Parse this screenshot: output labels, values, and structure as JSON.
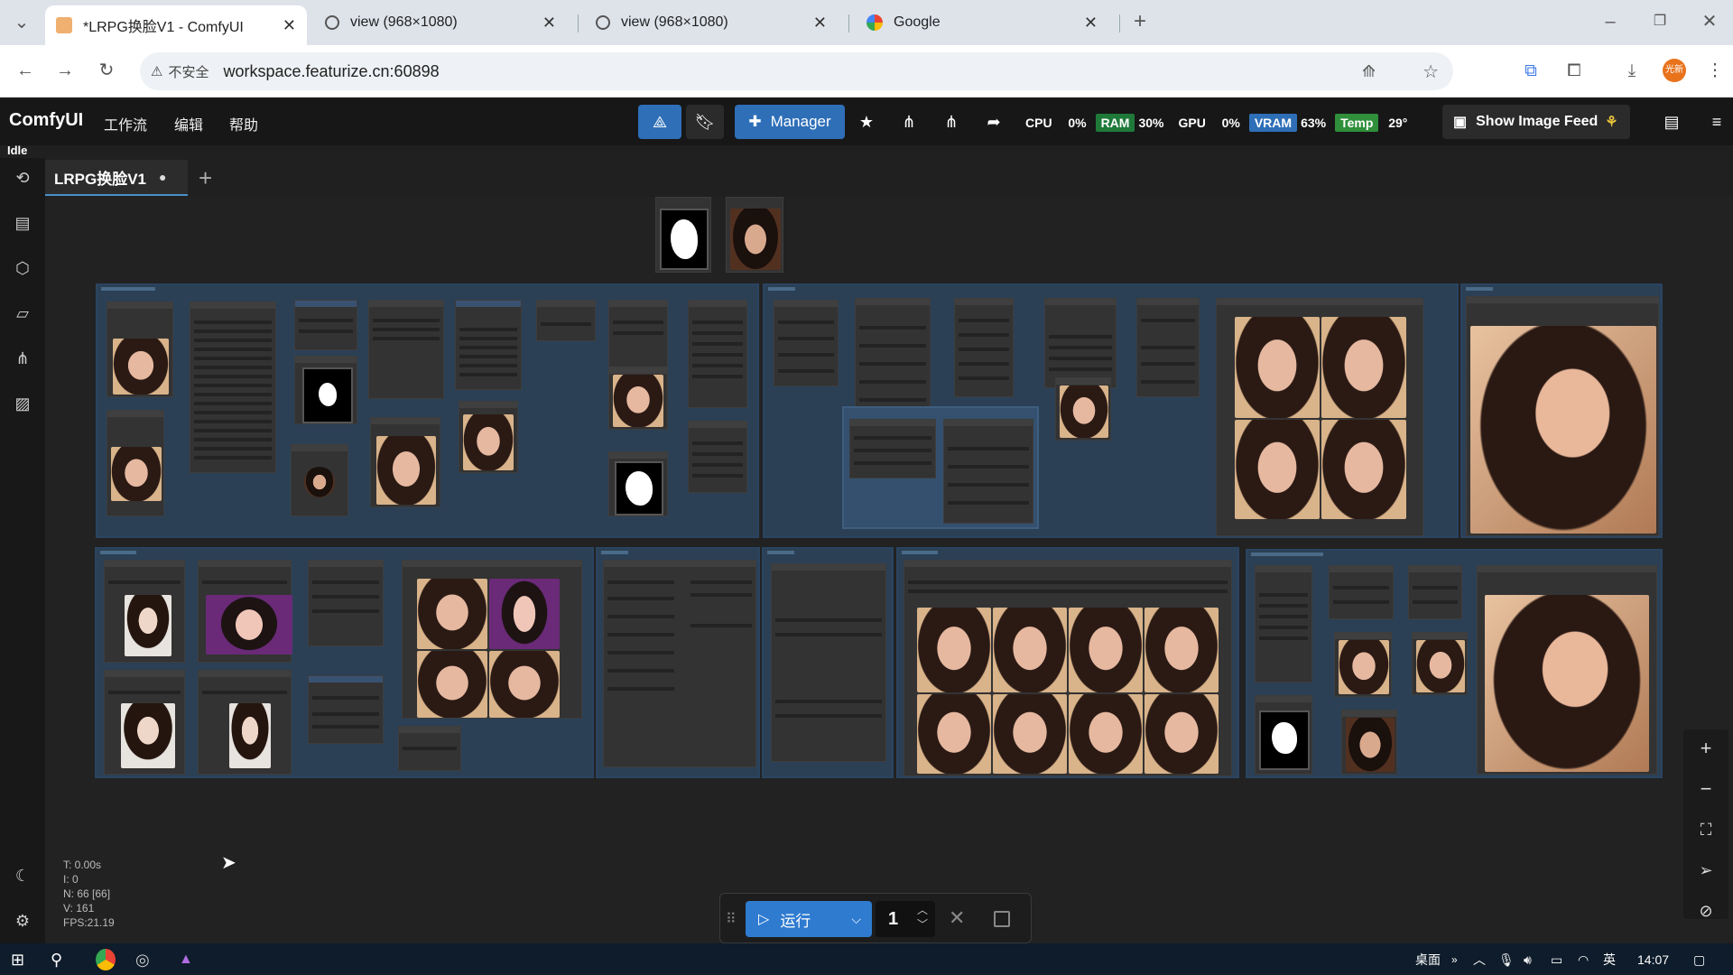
{
  "browser": {
    "tabs": [
      {
        "title": "*LRPG换脸V1 - ComfyUI",
        "active": true
      },
      {
        "title": "view (968×1080)",
        "active": false
      },
      {
        "title": "view (968×1080)",
        "active": false
      },
      {
        "title": "Google",
        "active": false
      }
    ],
    "security_label": "不安全",
    "url": "workspace.featurize.cn:60898",
    "profile_badge": "光新"
  },
  "comfy": {
    "logo": "ComfyUI",
    "menu": [
      "工作流",
      "编辑",
      "帮助"
    ],
    "manager_label": "Manager",
    "stats": [
      {
        "label": "CPU",
        "value": "0%",
        "color": "#171717"
      },
      {
        "label": "RAM",
        "value": "30%",
        "color": "#1f7a3a"
      },
      {
        "label": "GPU",
        "value": "0%",
        "color": "#171717"
      },
      {
        "label": "VRAM",
        "value": "63%",
        "color": "#2e6fb8"
      },
      {
        "label": "Temp",
        "value": "29°",
        "color": "#2f8f3a"
      }
    ],
    "show_image_feed": "Show Image Feed",
    "status": "Idle",
    "workflow_tab": "LRPG换脸V1",
    "workflow_tab_modified": "●",
    "perf": {
      "t": "T: 0.00s",
      "i": "I: 0",
      "n": "N: 66 [66]",
      "v": "V: 161",
      "fps": "FPS:21.19"
    },
    "run_label": "运行",
    "queue_count": "1"
  },
  "taskbar": {
    "desktop_label": "桌面",
    "ime": "英",
    "time": "14:07"
  },
  "colors": {
    "accent_blue": "#2e7bd0",
    "group_bg": "#2b4055"
  }
}
